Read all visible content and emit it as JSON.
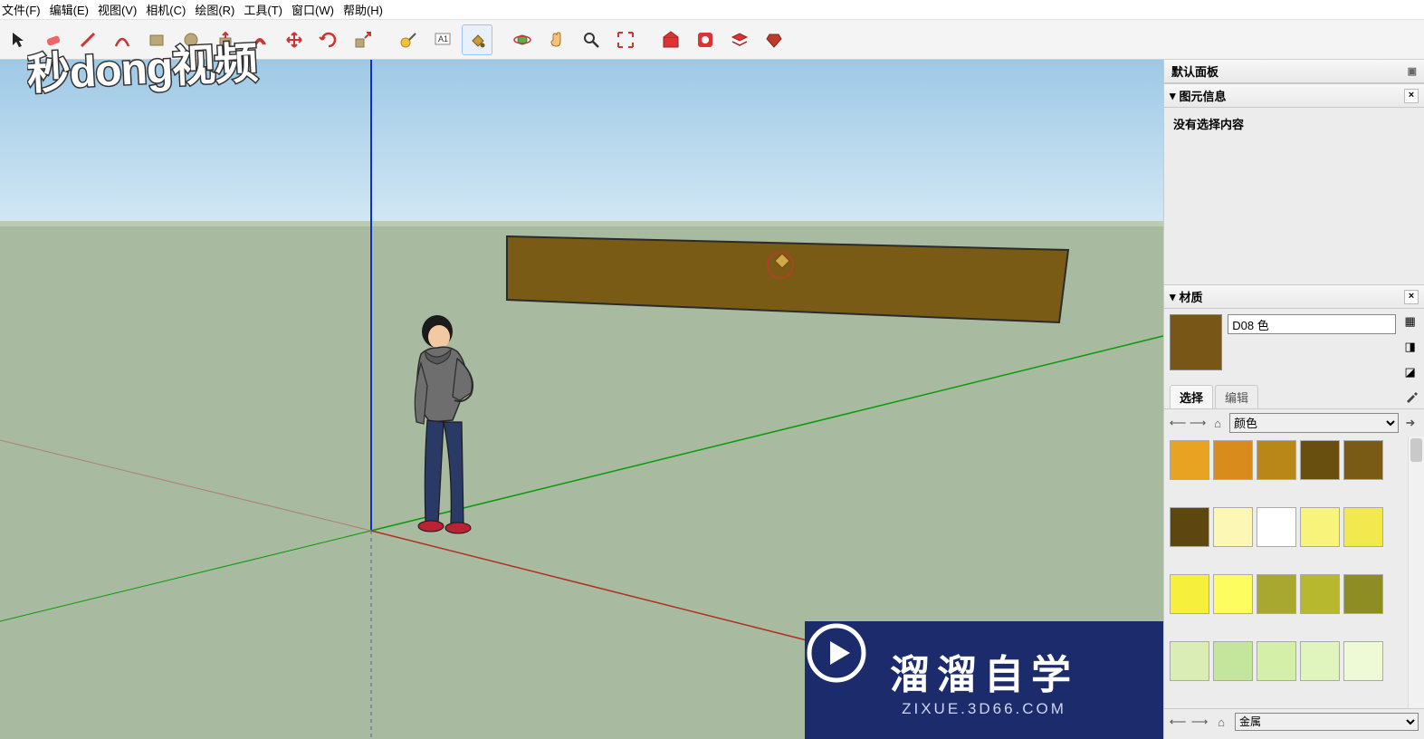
{
  "menu": {
    "file": "文件(F)",
    "edit": "编辑(E)",
    "view": "视图(V)",
    "camera": "相机(C)",
    "draw": "绘图(R)",
    "tools": "工具(T)",
    "window": "窗口(W)",
    "help": "帮助(H)"
  },
  "toolbar_icons": [
    "select-icon",
    "eraser-icon",
    "line-icon",
    "arc-icon",
    "rect-icon",
    "circle-icon",
    "pushpull-icon",
    "offset-icon",
    "move-icon",
    "rotate-icon",
    "scale-icon",
    "tape-icon",
    "text-icon",
    "paint-icon",
    "orbit-icon",
    "pan-icon",
    "zoom-icon",
    "zoom-extents-icon",
    "layers-icon",
    "outliner-icon",
    "scenes-icon",
    "ruby-icon"
  ],
  "sidepanel": {
    "default_panel": "默认面板",
    "entity_info_title": "图元信息",
    "entity_info_body": "没有选择内容",
    "materials_title": "材质",
    "material_name": "D08 色",
    "tab_select": "选择",
    "tab_edit": "编辑",
    "dropdown_colors": "颜色",
    "footer_dropdown": "金属",
    "swatch_colors": [
      "#e8a323",
      "#d98c1b",
      "#b98718",
      "#694f0f",
      "#7a5b16",
      "#5e4611",
      "#fdf7b5",
      "#ffffff",
      "#f8f37a",
      "#f2e94e",
      "#f6f03c",
      "#fdfd5f",
      "#a8a830",
      "#b7b82e",
      "#8d8d24",
      "#d9edb4",
      "#c4e59c",
      "#d4f0a8",
      "#e0f5bd",
      "#eef9d6"
    ]
  },
  "watermark1": "秒dong视频",
  "watermark2": {
    "main": "溜溜自学",
    "sub": "ZIXUE.3D66.COM"
  }
}
